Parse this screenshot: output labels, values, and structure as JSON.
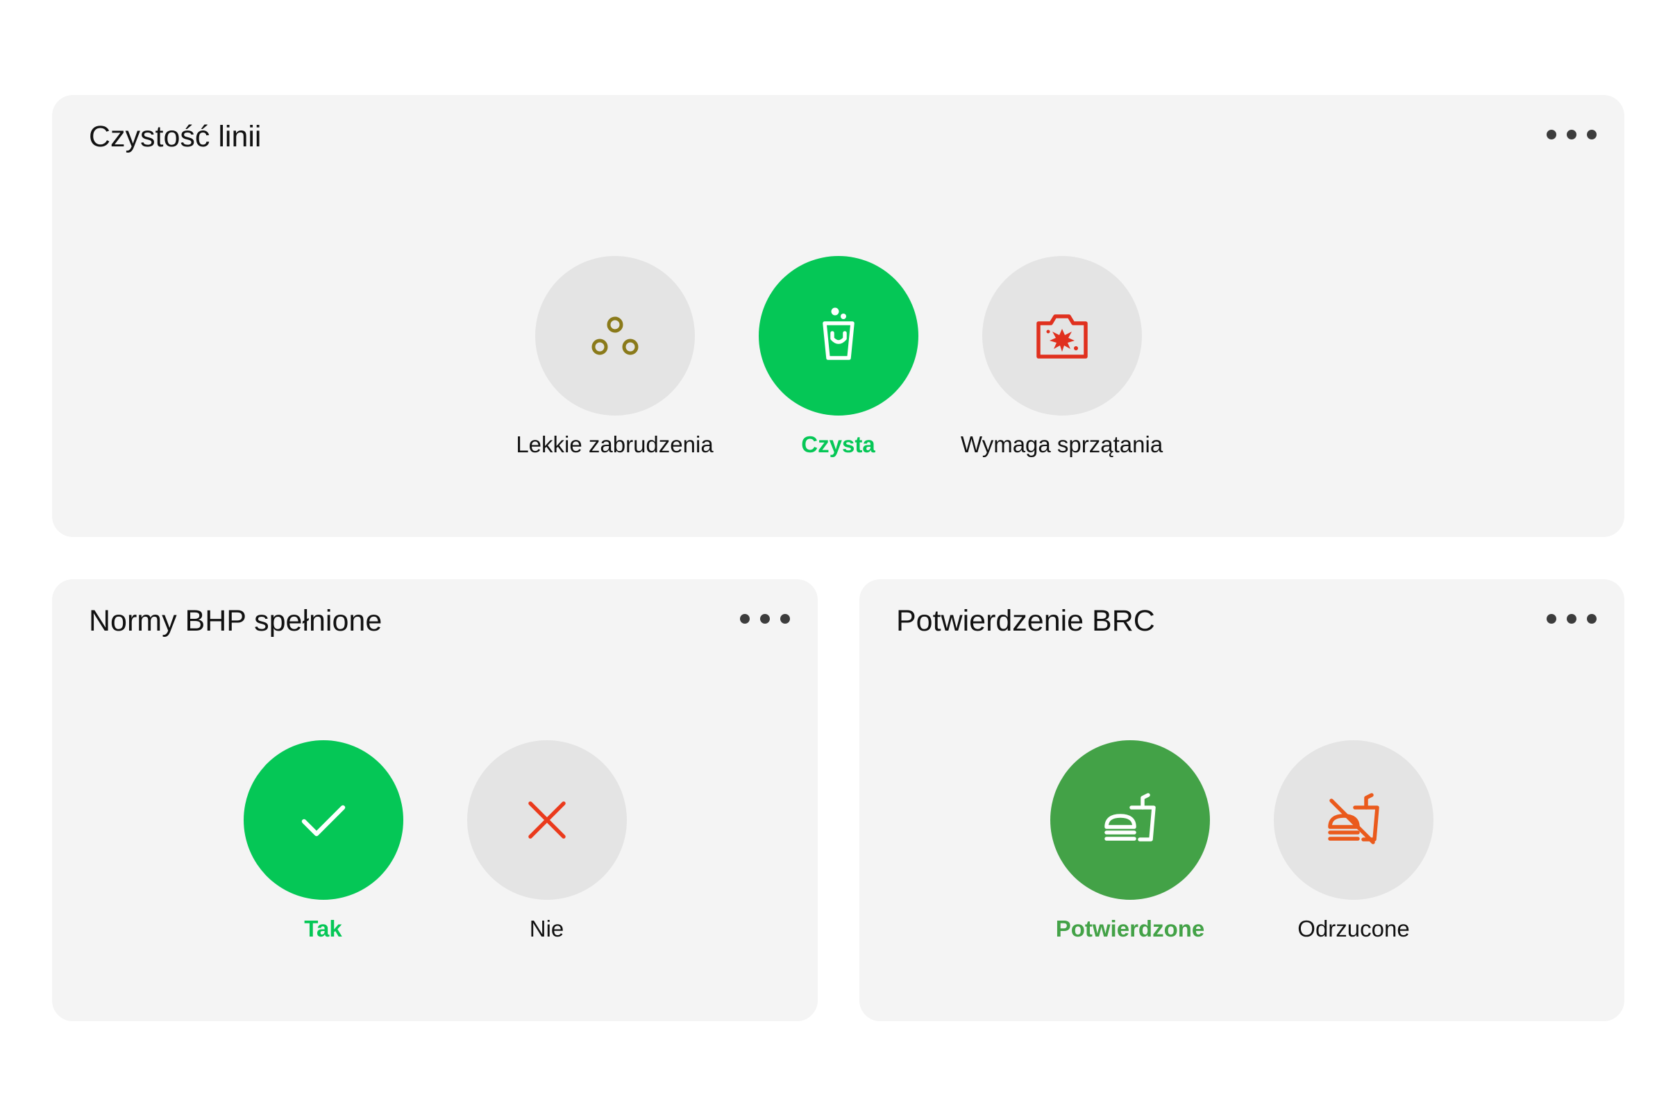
{
  "colors": {
    "card_bg": "#f4f4f4",
    "circle_default": "#e4e4e4",
    "selected_green": "#05c756",
    "selected_dark_green": "#43a247",
    "olive_icon": "#8a7a1a",
    "red_icon": "#e0301e",
    "orange_icon": "#ea5a1c"
  },
  "cleanliness": {
    "title": "Czystość linii",
    "options": [
      {
        "label": "Lekkie zabrudzenia",
        "icon": "three-circles-icon",
        "selected": false
      },
      {
        "label": "Czysta",
        "icon": "clean-cup-icon",
        "selected": true
      },
      {
        "label": "Wymaga sprzątania",
        "icon": "dirty-camera-icon",
        "selected": false
      }
    ]
  },
  "bhp": {
    "title": "Normy BHP spełnione",
    "options": [
      {
        "label": "Tak",
        "icon": "check-icon",
        "selected": true
      },
      {
        "label": "Nie",
        "icon": "close-icon",
        "selected": false
      }
    ]
  },
  "brc": {
    "title": "Potwierdzenie BRC",
    "options": [
      {
        "label": "Potwierdzone",
        "icon": "fastfood-icon",
        "selected": true
      },
      {
        "label": "Odrzucone",
        "icon": "no-fastfood-icon",
        "selected": false
      }
    ]
  }
}
